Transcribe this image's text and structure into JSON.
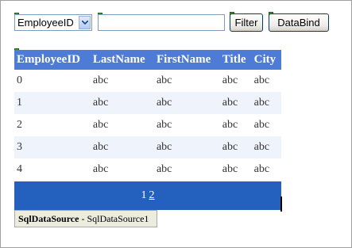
{
  "toolbar": {
    "field_select": {
      "value": "EmployeeID"
    },
    "filter_input": {
      "value": ""
    },
    "filter_label": "Filter",
    "databind_label": "DataBind"
  },
  "grid": {
    "columns": [
      "EmployeeID",
      "LastName",
      "FirstName",
      "Title",
      "City"
    ],
    "rows": [
      [
        "0",
        "abc",
        "abc",
        "abc",
        "abc"
      ],
      [
        "1",
        "abc",
        "abc",
        "abc",
        "abc"
      ],
      [
        "2",
        "abc",
        "abc",
        "abc",
        "abc"
      ],
      [
        "3",
        "abc",
        "abc",
        "abc",
        "abc"
      ],
      [
        "4",
        "abc",
        "abc",
        "abc",
        "abc"
      ]
    ],
    "header_color": "#4d7bd6",
    "alt_row_color": "#eff3fb"
  },
  "pager": {
    "current_page": "1",
    "next_page": "2",
    "color": "#2461bf"
  },
  "datasource": {
    "type": "SqlDataSource",
    "separator": " - ",
    "id": "SqlDataSource1"
  }
}
